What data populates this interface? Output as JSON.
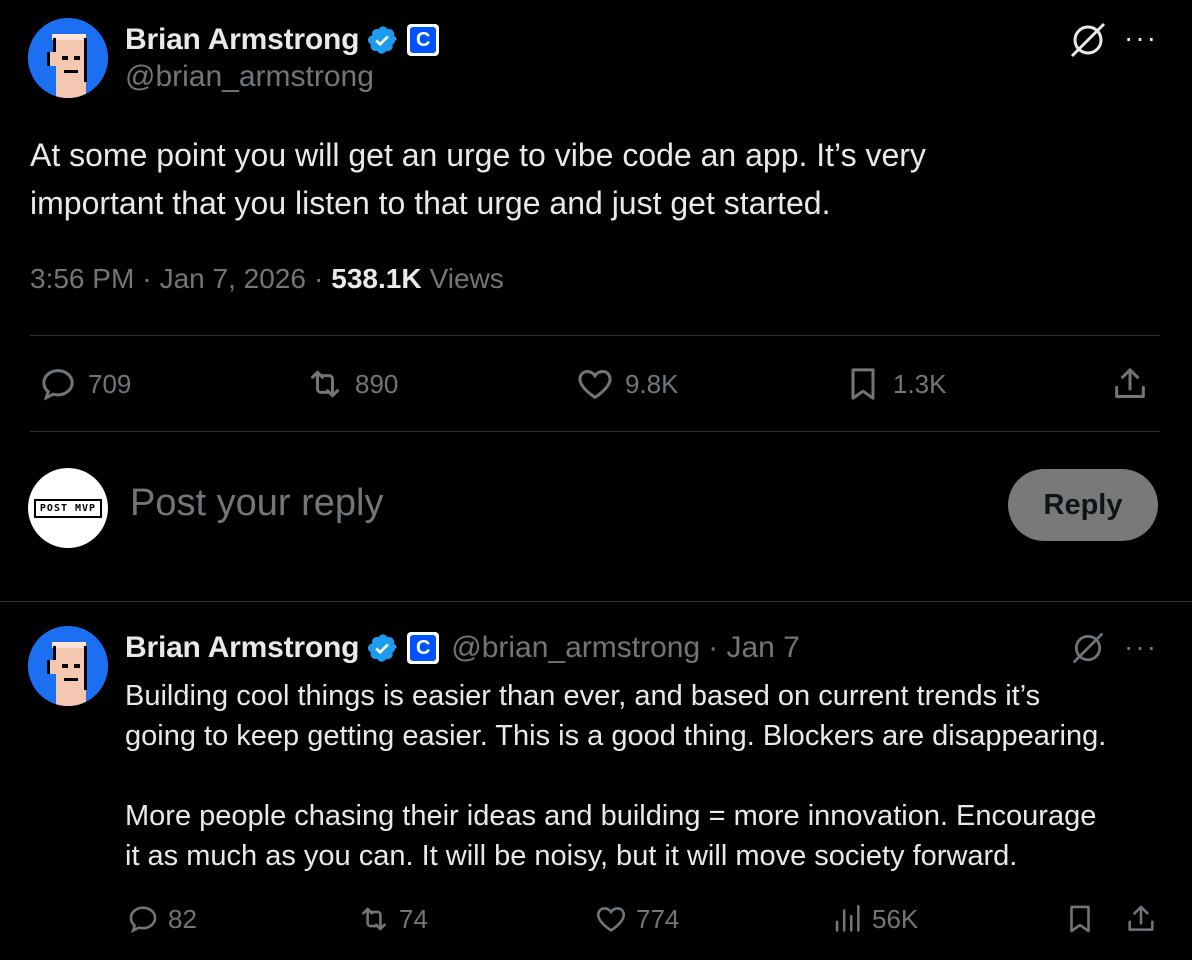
{
  "main_tweet": {
    "author": {
      "name": "Brian Armstrong",
      "handle": "@brian_armstrong",
      "coin_badge": "C"
    },
    "text_line1": "At some point you will get an urge to vibe code an app. It’s very",
    "text_line2": "important that you listen to that urge and just get started.",
    "time": "3:56 PM",
    "date": "Jan 7, 2026",
    "views_count": "538.1K",
    "views_label": "Views",
    "dot": "·",
    "actions": {
      "replies": "709",
      "reposts": "890",
      "likes": "9.8K",
      "bookmarks": "1.3K"
    }
  },
  "reply_composer": {
    "avatar_text": "POST MVP",
    "placeholder": "Post your reply",
    "button_label": "Reply"
  },
  "reply_tweet": {
    "author": {
      "name": "Brian Armstrong",
      "handle": "@brian_armstrong",
      "coin_badge": "C"
    },
    "date": "· Jan 7",
    "p1_line1": "Building cool things is easier than ever, and based on current trends it’s",
    "p1_line2": "going to keep getting easier. This is a good thing. Blockers are disappearing.",
    "p2_line1": "More people chasing their ideas and building = more innovation. Encourage",
    "p2_line2": "it as much as you can. It will be noisy, but it will move society forward.",
    "actions": {
      "replies": "82",
      "reposts": "74",
      "likes": "774",
      "views": "56K"
    }
  },
  "colors": {
    "background": "#000000",
    "text": "#e7e9ea",
    "muted": "#71767b",
    "verified_blue": "#1d9bf0",
    "coinbase_blue": "#0052ff",
    "divider": "#2f3336"
  }
}
